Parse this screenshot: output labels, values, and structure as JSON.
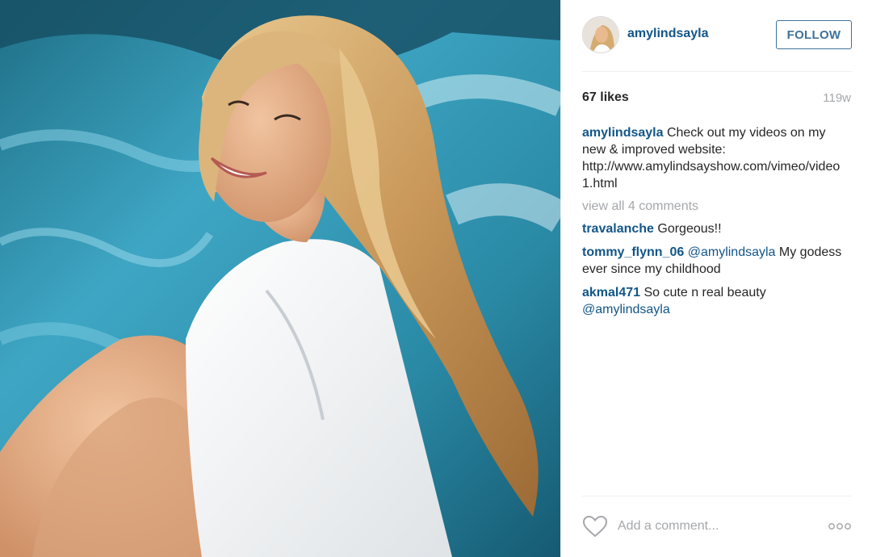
{
  "post": {
    "image_alt": "woman in white shirt smiling beside a pool",
    "author": {
      "username": "amylindsayla"
    },
    "follow_label": "FOLLOW",
    "likes": "67 likes",
    "age": "119w",
    "caption": {
      "username": "amylindsayla",
      "text_line1": " Check out my videos on my new & improved website: ",
      "url": "http://www.amylindsayshow.com/vimeo/video1.html"
    },
    "view_all": "view all 4 comments",
    "comments": [
      {
        "username": "travalanche",
        "text": " Gorgeous!!"
      },
      {
        "username": "tommy_flynn_06",
        "mention": "@amylindsayla",
        "text": " My godess ever since my childhood"
      },
      {
        "username": "akmal471",
        "text": " So cute n real beauty ",
        "mention": "@amylindsayla"
      }
    ],
    "add_comment_placeholder": "Add a comment...",
    "icons": {
      "like": "heart-icon",
      "options": "more-options-icon"
    }
  },
  "colors": {
    "link": "#125688",
    "follow": "#3f729b",
    "muted": "#a5a7aa",
    "divider": "#efefef"
  }
}
